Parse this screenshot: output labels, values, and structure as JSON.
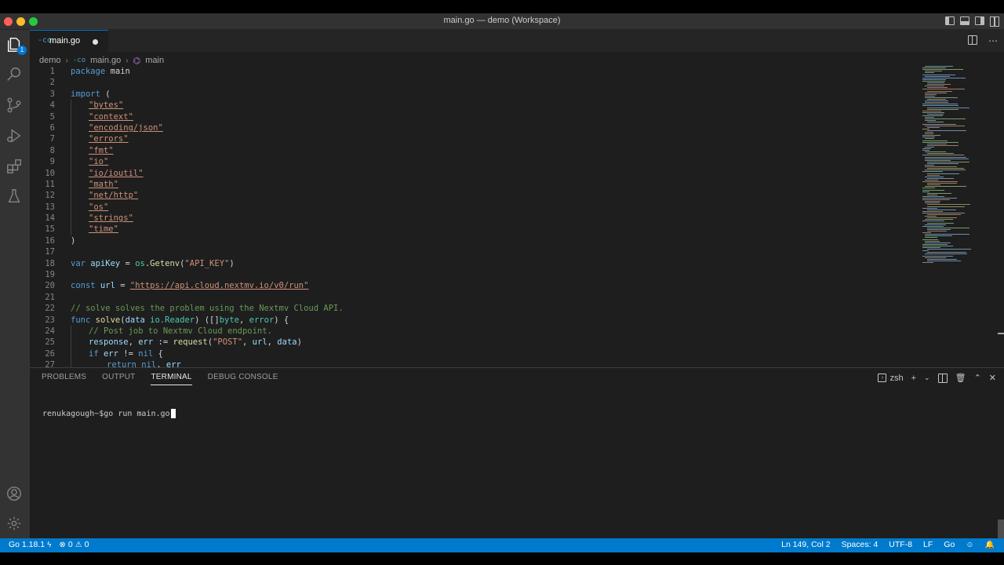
{
  "window": {
    "title": "main.go — demo (Workspace)"
  },
  "activity": {
    "explorer_badge": "1"
  },
  "tab": {
    "icon": "-co",
    "label": "main.go"
  },
  "breadcrumb": {
    "folder": "demo",
    "file_icon": "-co",
    "file": "main.go",
    "symbol": "main"
  },
  "code": {
    "lines": [
      {
        "n": "1"
      },
      {
        "n": "2"
      },
      {
        "n": "3"
      },
      {
        "n": "4"
      },
      {
        "n": "5"
      },
      {
        "n": "6"
      },
      {
        "n": "7"
      },
      {
        "n": "8"
      },
      {
        "n": "9"
      },
      {
        "n": "10"
      },
      {
        "n": "11"
      },
      {
        "n": "12"
      },
      {
        "n": "13"
      },
      {
        "n": "14"
      },
      {
        "n": "15"
      },
      {
        "n": "16"
      },
      {
        "n": "17"
      },
      {
        "n": "18"
      },
      {
        "n": "19"
      },
      {
        "n": "20"
      },
      {
        "n": "21"
      },
      {
        "n": "22"
      },
      {
        "n": "23"
      },
      {
        "n": "24"
      },
      {
        "n": "25"
      },
      {
        "n": "26"
      },
      {
        "n": "27"
      }
    ],
    "t": {
      "package": "package",
      "main": " main",
      "import": "import",
      "lparen": " (",
      "rparen": ")",
      "imp_bytes": "\"bytes\"",
      "imp_context": "\"context\"",
      "imp_json": "\"encoding/json\"",
      "imp_errors": "\"errors\"",
      "imp_fmt": "\"fmt\"",
      "imp_io": "\"io\"",
      "imp_ioutil": "\"io/ioutil\"",
      "imp_math": "\"math\"",
      "imp_http": "\"net/http\"",
      "imp_os": "\"os\"",
      "imp_strings": "\"strings\"",
      "imp_time": "\"time\"",
      "var": "var",
      "apikey": " apiKey",
      "eq": " = ",
      "os_pkg": "os",
      "getenv": ".Getenv",
      "apikey_str": "\"API_KEY\"",
      "const": "const",
      "url_name": " url",
      "url_str": "\"https://api.cloud.nextmv.io/v0/run\"",
      "comment_solve": "// solve solves the problem using the Nextmv Cloud API.",
      "func": "func",
      "solve": " solve",
      "data_param": "data",
      "io_pkg": " io",
      "reader": ".Reader",
      "byte": "byte",
      "error_t": "error",
      "brace": " {",
      "comment_post": "// Post job to Nextmv Cloud endpoint.",
      "response": "response",
      "err": " err",
      "assign": " := ",
      "request": "request",
      "post_str": "\"POST\"",
      "url_arg": " url",
      "data_arg": " data",
      "if": "if",
      "err2": " err",
      "neq": " != ",
      "nil": "nil",
      "return": "return",
      "nil2": " nil",
      "err3": " err"
    }
  },
  "panel": {
    "tabs": [
      "PROBLEMS",
      "OUTPUT",
      "TERMINAL",
      "DEBUG CONSOLE"
    ],
    "shell": "zsh",
    "prompt": "renukagough~$go run main.go"
  },
  "status": {
    "go_version": "Go 1.18.1",
    "errors": "0",
    "warnings": "0",
    "position": "Ln 149, Col 2",
    "spaces": "Spaces: 4",
    "encoding": "UTF-8",
    "eol": "LF",
    "language": "Go"
  },
  "colors": {
    "accent": "#007acc",
    "tab_border": "#0078d4",
    "editor_bg": "#1e1e1e"
  }
}
